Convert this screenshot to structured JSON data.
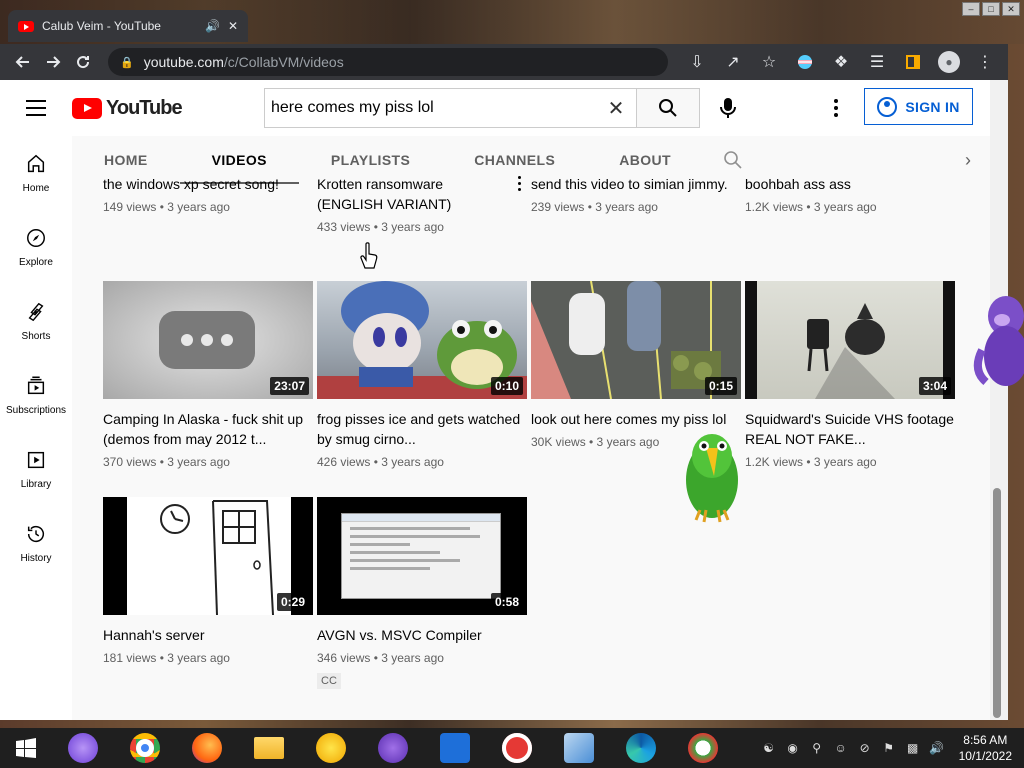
{
  "browser": {
    "tab_title": "Calub Veim - YouTube",
    "url_host": "youtube.com",
    "url_path": "/c/CollabVM/videos"
  },
  "masthead": {
    "logo_text": "YouTube",
    "search_value": "here comes my piss lol",
    "sign_in_label": "SIGN IN"
  },
  "sidebar": {
    "items": [
      {
        "label": "Home",
        "icon": "home-icon"
      },
      {
        "label": "Explore",
        "icon": "compass-icon"
      },
      {
        "label": "Shorts",
        "icon": "shorts-icon"
      },
      {
        "label": "Subscriptions",
        "icon": "subscriptions-icon"
      },
      {
        "label": "Library",
        "icon": "library-icon"
      },
      {
        "label": "History",
        "icon": "history-icon"
      }
    ]
  },
  "channel_tabs": [
    "HOME",
    "VIDEOS",
    "PLAYLISTS",
    "CHANNELS",
    "ABOUT"
  ],
  "videos": {
    "row0": [
      {
        "title": "the windows xp secret song!",
        "meta": "149 views • 3 years ago"
      },
      {
        "title": "Krotten ransomware (ENGLISH VARIANT)",
        "meta": "433 views • 3 years ago"
      },
      {
        "title": "send this video to simian jimmy.",
        "meta": "239 views • 3 years ago"
      },
      {
        "title": "boohbah ass ass",
        "meta": "1.2K views • 3 years ago"
      }
    ],
    "row1": [
      {
        "title": "Camping In Alaska - fuck shit up (demos from may 2012 t...",
        "meta": "370 views • 3 years ago",
        "duration": "23:07"
      },
      {
        "title": "frog pisses ice and gets watched by smug cirno...",
        "meta": "426 views • 3 years ago",
        "duration": "0:10"
      },
      {
        "title": "look out here comes my piss lol",
        "meta": "30K views • 3 years ago",
        "duration": "0:15"
      },
      {
        "title": "Squidward's Suicide VHS footage REAL NOT FAKE...",
        "meta": "1.2K views • 3 years ago",
        "duration": "3:04"
      }
    ],
    "row2": [
      {
        "title": "Hannah's server",
        "meta": "181 views • 3 years ago",
        "duration": "0:29"
      },
      {
        "title": "AVGN vs. MSVC Compiler",
        "meta": "346 views • 3 years ago",
        "duration": "0:58",
        "badge": "CC"
      }
    ]
  },
  "taskbar": {
    "time": "8:56 AM",
    "date": "10/1/2022"
  },
  "colors": {
    "youtube_red": "#ff0000",
    "link_blue": "#065fd4",
    "chrome_dark": "#35363a",
    "taskbar": "#1f1f1f"
  }
}
